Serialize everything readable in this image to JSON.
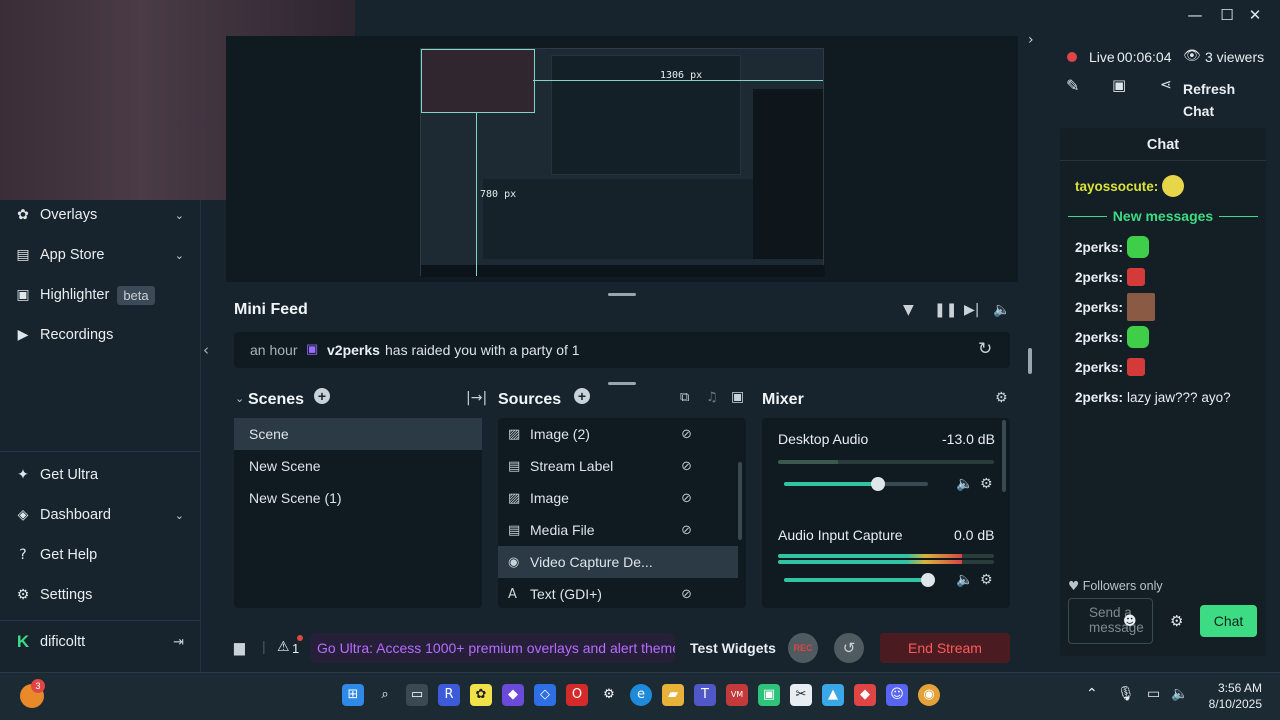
{
  "titlebar": {
    "minimize": "—",
    "maximize": "☐",
    "close": "✕"
  },
  "sidebar": {
    "items": [
      {
        "label": "Overlays",
        "icon": "overlays-icon",
        "chevron": true
      },
      {
        "label": "App Store",
        "icon": "app-store-icon",
        "chevron": true
      },
      {
        "label": "Highlighter",
        "icon": "highlighter-icon",
        "badge": "beta"
      },
      {
        "label": "Recordings",
        "icon": "recordings-icon"
      }
    ],
    "bottom_items": [
      {
        "label": "Get Ultra",
        "icon": "ultra-icon"
      },
      {
        "label": "Dashboard",
        "icon": "dashboard-icon",
        "chevron": true
      },
      {
        "label": "Get Help",
        "icon": "help-icon"
      },
      {
        "label": "Settings",
        "icon": "gear-icon"
      }
    ],
    "user": {
      "name": "dificoltt"
    }
  },
  "preview": {
    "width_label": "1306 px",
    "height_label": "780 px"
  },
  "minifeed": {
    "title": "Mini Feed",
    "event": {
      "time": "an hour",
      "user": "v2perks",
      "text": "has raided you with a party of 1"
    }
  },
  "scenes": {
    "title": "Scenes",
    "items": [
      "Scene",
      "New Scene",
      "New Scene (1)"
    ],
    "selected": 0
  },
  "sources": {
    "title": "Sources",
    "items": [
      {
        "label": "Image (2)",
        "icon": "image-icon"
      },
      {
        "label": "Stream Label",
        "icon": "file-icon"
      },
      {
        "label": "Image",
        "icon": "image-icon"
      },
      {
        "label": "Media File",
        "icon": "file-icon"
      },
      {
        "label": "Video Capture De...",
        "icon": "webcam-icon"
      },
      {
        "label": "Text (GDI+)",
        "icon": "text-icon"
      }
    ],
    "selected": 4
  },
  "mixer": {
    "title": "Mixer",
    "channels": [
      {
        "name": "Desktop Audio",
        "db": "-13.0 dB",
        "meter_level": 0.28,
        "volume": 0.65
      },
      {
        "name": "Audio Input Capture",
        "db": "0.0 dB",
        "meter_level": 0.85,
        "volume": 1.0
      }
    ]
  },
  "footer": {
    "warnings_count": "1",
    "promo": "Go Ultra: Access 1000+ premium overlays and alert theme",
    "test_widgets": "Test Widgets",
    "rec": "REC",
    "end_stream": "End Stream"
  },
  "live": {
    "status": "Live",
    "time": "00:06:04",
    "viewers": "3 viewers",
    "refresh": "Refresh Chat"
  },
  "chat": {
    "title": "Chat",
    "messages": [
      {
        "user": "tayossocute:",
        "emote": "pepe-yellow"
      },
      {
        "divider": "New messages"
      },
      {
        "user": "2perks:",
        "emote": "green-face"
      },
      {
        "user": "2perks:",
        "emote": "red-angry"
      },
      {
        "user": "2perks:",
        "emote": "photo-face"
      },
      {
        "user": "2perks:",
        "emote": "green-face"
      },
      {
        "user": "2perks:",
        "emote": "red-angry"
      },
      {
        "user": "2perks:",
        "text": "lazy jaw??? ayo?"
      }
    ],
    "followers_only": "Followers only",
    "input_placeholder": "Send a message",
    "send_label": "Chat"
  },
  "taskbar": {
    "notif_badge": "3",
    "time": "3:56 AM",
    "date": "8/10/2025"
  },
  "colors": {
    "accent_green": "#3ddc84",
    "live_red": "#e04545",
    "end_stream_bg": "#4a1c22",
    "promo_text": "#b86cff"
  }
}
